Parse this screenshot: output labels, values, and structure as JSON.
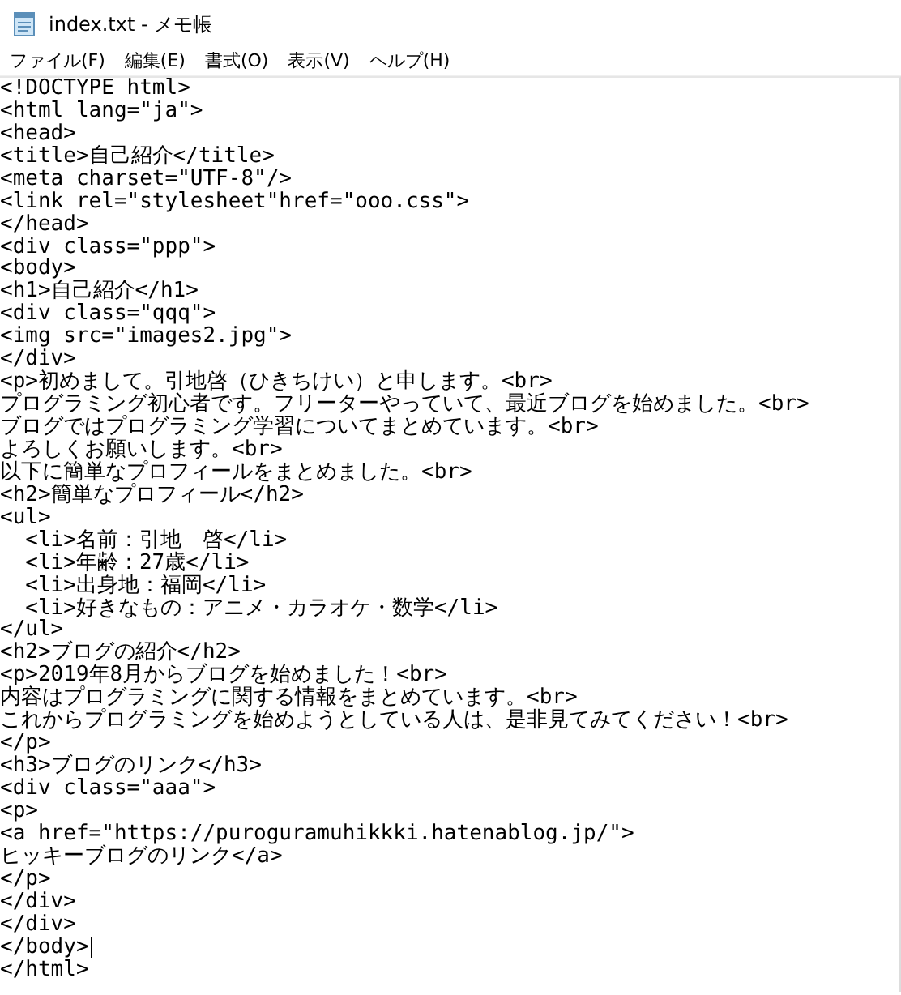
{
  "window": {
    "title": "index.txt - メモ帳"
  },
  "menu": [
    "ファイル(F)",
    "編集(E)",
    "書式(O)",
    "表示(V)",
    "ヘルプ(H)"
  ],
  "editor": {
    "lines": [
      {
        "text": "<!DOCTYPE html>",
        "caret": false
      },
      {
        "text": "<html lang=\"ja\">",
        "caret": false
      },
      {
        "text": "<head>",
        "caret": false
      },
      {
        "text": "<title>自己紹介</title>",
        "caret": false
      },
      {
        "text": "<meta charset=\"UTF-8\"/>",
        "caret": false
      },
      {
        "text": "<link rel=\"stylesheet\"href=\"ooo.css\">",
        "caret": false
      },
      {
        "text": "</head>",
        "caret": false
      },
      {
        "text": "<div class=\"ppp\">",
        "caret": false
      },
      {
        "text": "<body>",
        "caret": false
      },
      {
        "text": "<h1>自己紹介</h1>",
        "caret": false
      },
      {
        "text": "<div class=\"qqq\">",
        "caret": false
      },
      {
        "text": "<img src=\"images2.jpg\">",
        "caret": false
      },
      {
        "text": "</div>",
        "caret": false
      },
      {
        "text": "<p>初めまして。引地啓（ひきちけい）と申します。<br>",
        "caret": false
      },
      {
        "text": "プログラミング初心者です。フリーターやっていて、最近ブログを始めました。<br>",
        "caret": false
      },
      {
        "text": "ブログではプログラミング学習についてまとめています。<br>",
        "caret": false
      },
      {
        "text": "よろしくお願いします。<br>",
        "caret": false
      },
      {
        "text": "以下に簡単なプロフィールをまとめました。<br>",
        "caret": false
      },
      {
        "text": "<h2>簡単なプロフィール</h2>",
        "caret": false
      },
      {
        "text": "<ul>",
        "caret": false
      },
      {
        "text": "  <li>名前：引地　啓</li>",
        "caret": false
      },
      {
        "text": "  <li>年齢：27歳</li>",
        "caret": false
      },
      {
        "text": "  <li>出身地：福岡</li>",
        "caret": false
      },
      {
        "text": "  <li>好きなもの：アニメ・カラオケ・数学</li>",
        "caret": false
      },
      {
        "text": "</ul>",
        "caret": false
      },
      {
        "text": "<h2>ブログの紹介</h2>",
        "caret": false
      },
      {
        "text": "<p>2019年8月からブログを始めました！<br>",
        "caret": false
      },
      {
        "text": "内容はプログラミングに関する情報をまとめています。<br>",
        "caret": false
      },
      {
        "text": "これからプログラミングを始めようとしている人は、是非見てみてください！<br>",
        "caret": false
      },
      {
        "text": "</p>",
        "caret": false
      },
      {
        "text": "<h3>ブログのリンク</h3>",
        "caret": false
      },
      {
        "text": "<div class=\"aaa\">",
        "caret": false
      },
      {
        "text": "<p>",
        "caret": false
      },
      {
        "text": "<a href=\"https://puroguramuhikkki.hatenablog.jp/\">",
        "caret": false
      },
      {
        "text": "ヒッキーブログのリンク</a>",
        "caret": false
      },
      {
        "text": "</p>",
        "caret": false
      },
      {
        "text": "</div>",
        "caret": false
      },
      {
        "text": "</div>",
        "caret": false
      },
      {
        "text": "</body>",
        "caret": true
      },
      {
        "text": "</html>",
        "caret": false
      }
    ]
  }
}
